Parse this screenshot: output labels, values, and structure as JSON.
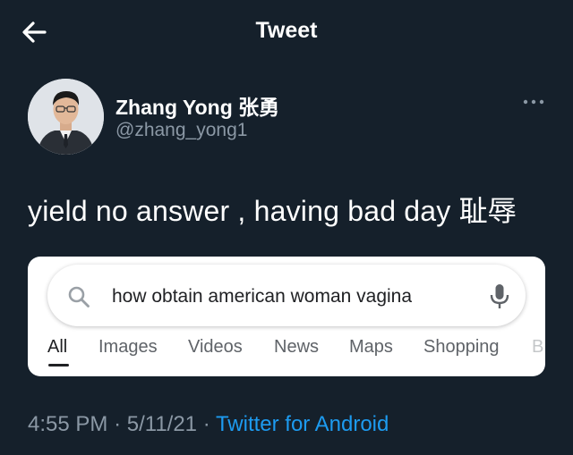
{
  "header": {
    "title": "Tweet",
    "back_icon": "arrow-left-icon"
  },
  "author": {
    "name": "Zhang Yong 张勇",
    "handle": "@zhang_yong1"
  },
  "more_icon": "more-horizontal-icon",
  "tweet": {
    "text": "yield no answer , having bad day 耻辱"
  },
  "screenshot_card": {
    "search_query": "how obtain american woman vagina",
    "search_icon": "search-icon",
    "mic_icon": "microphone-icon",
    "tabs": [
      {
        "label": "All",
        "active": true
      },
      {
        "label": "Images"
      },
      {
        "label": "Videos"
      },
      {
        "label": "News"
      },
      {
        "label": "Maps"
      },
      {
        "label": "Shopping"
      },
      {
        "label": "B"
      }
    ]
  },
  "meta": {
    "time": "4:55 PM",
    "separator": "·",
    "date": "5/11/21",
    "source": "Twitter for Android"
  },
  "colors": {
    "background": "#15202b",
    "secondary_text": "#8b98a5",
    "link": "#1d9bf0",
    "card": "#ffffff"
  }
}
